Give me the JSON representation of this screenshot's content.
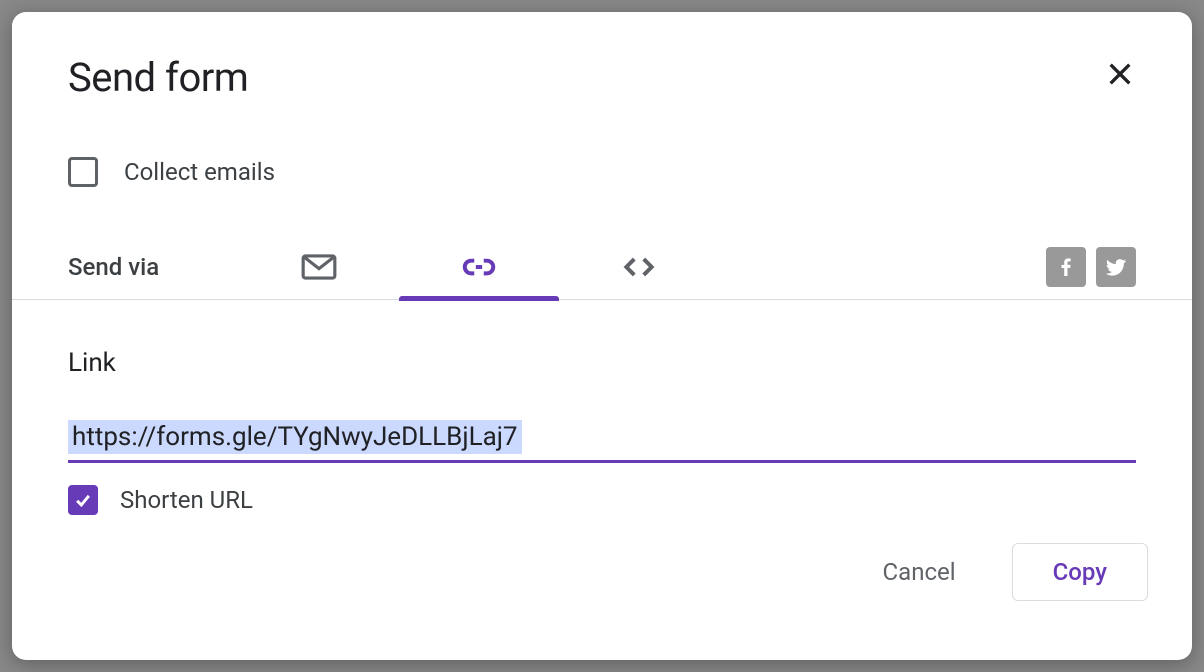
{
  "dialog": {
    "title": "Send form",
    "collect_emails_label": "Collect emails",
    "collect_emails_checked": false,
    "send_via_label": "Send via",
    "tabs": {
      "active": "link"
    },
    "link": {
      "section_label": "Link",
      "url": "https://forms.gle/TYgNwyJeDLLBjLaj7",
      "shorten_label": "Shorten URL",
      "shorten_checked": true
    },
    "footer": {
      "cancel_label": "Cancel",
      "copy_label": "Copy"
    }
  },
  "colors": {
    "accent": "#673ab7"
  }
}
